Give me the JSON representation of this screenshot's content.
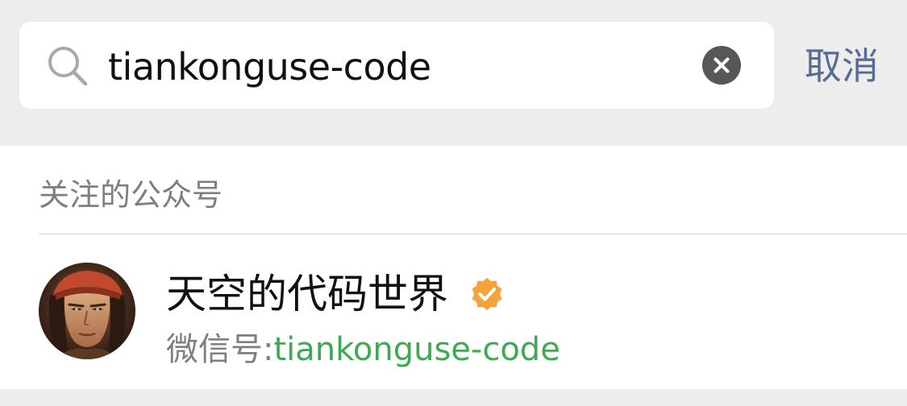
{
  "search": {
    "value": "tiankonguse-code",
    "placeholder": "",
    "cancel_label": "取消"
  },
  "results": {
    "section_title": "关注的公众号",
    "items": [
      {
        "name": "天空的代码世界",
        "id_prefix": "微信号:",
        "id_value": "tiankonguse-code",
        "verified": true
      }
    ]
  },
  "colors": {
    "background": "#ededed",
    "link_blue": "#576b95",
    "match_green": "#3daa52",
    "verified_orange": "#f4a23a",
    "secondary_text": "#7f7f7f"
  },
  "icons": {
    "search": "search-icon",
    "clear": "clear-icon",
    "verified": "verified-badge-icon"
  }
}
